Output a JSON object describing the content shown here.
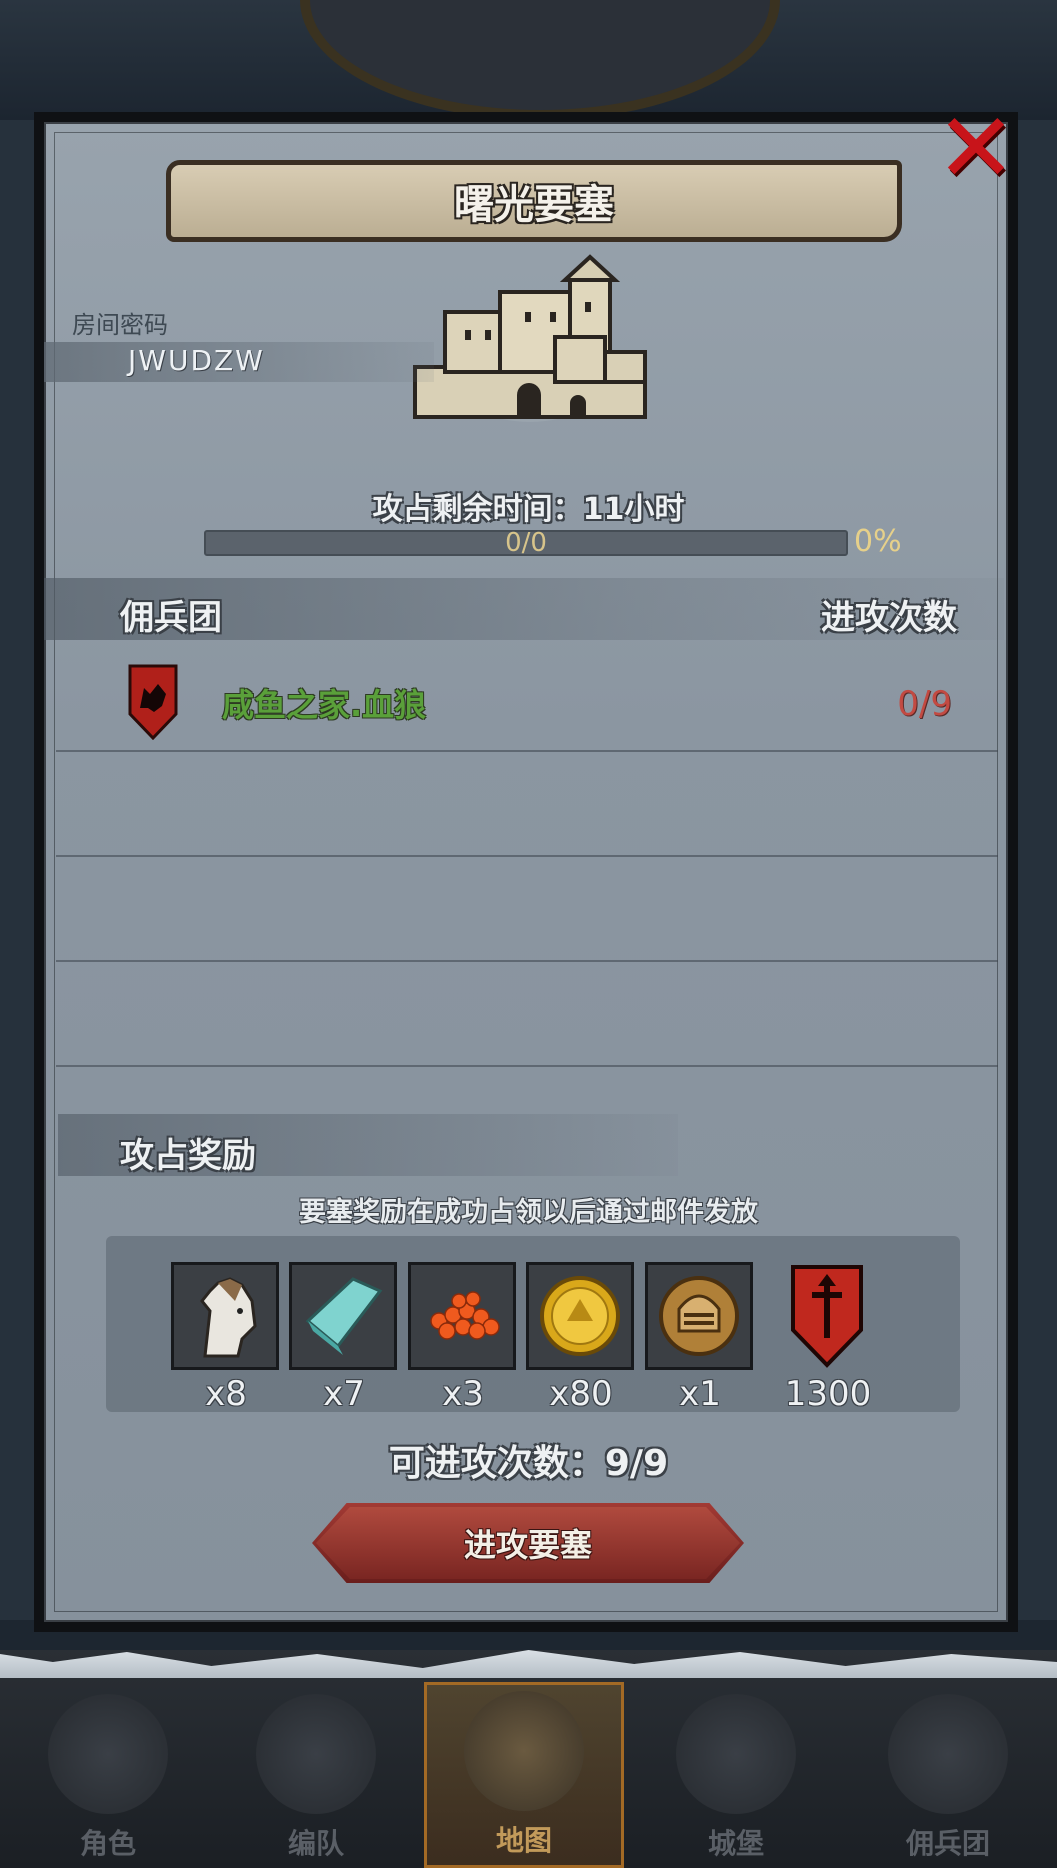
{
  "modal": {
    "title": "曙光要塞",
    "close_icon": "close-icon",
    "room_code_label": "房间密码",
    "room_code": "JWUDZW",
    "time_remaining": "攻占剩余时间：11小时",
    "progress": {
      "text": "0/0",
      "percent_label": "0%",
      "fraction": 0
    },
    "list_header": {
      "left": "佣兵团",
      "right": "进攻次数"
    },
    "guilds": [
      {
        "icon": "wolf-shield-icon",
        "name": "咸鱼之家.血狼",
        "count": "0/9"
      }
    ],
    "rewards": {
      "title": "攻占奖励",
      "note": "要塞奖励在成功占领以后通过邮件发放",
      "items": [
        {
          "icon": "horse-icon",
          "qty": "x8"
        },
        {
          "icon": "cloth-icon",
          "qty": "x7"
        },
        {
          "icon": "berries-icon",
          "qty": "x3"
        },
        {
          "icon": "gold-coin-icon",
          "qty": "x80"
        },
        {
          "icon": "knight-helmet-coin-icon",
          "qty": "x1"
        },
        {
          "icon": "guild-banner-icon",
          "qty": "1300"
        }
      ]
    },
    "attacks_available": "可进攻次数：9/9",
    "attack_button": "进攻要塞"
  },
  "bottom_nav": [
    {
      "label": "角色",
      "icon": "knight-icon",
      "active": false
    },
    {
      "label": "编队",
      "icon": "helmet-icon",
      "active": false
    },
    {
      "label": "地图",
      "icon": "compass-icon",
      "active": true
    },
    {
      "label": "城堡",
      "icon": "castle-icon",
      "active": false
    },
    {
      "label": "佣兵团",
      "icon": "ship-icon",
      "active": false
    }
  ],
  "colors": {
    "guild_name": "#5aa03a",
    "attack_count": "#c24a42",
    "button": "#8a2e28",
    "close": "#c8141a"
  }
}
